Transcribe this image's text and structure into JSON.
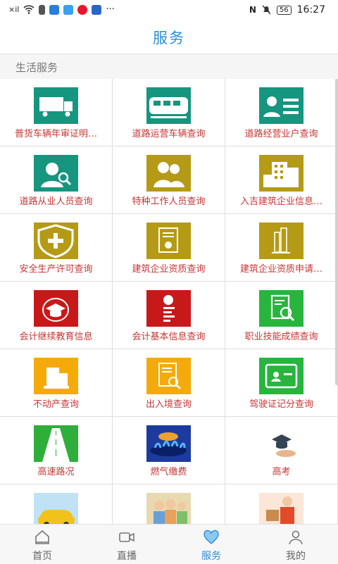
{
  "status_bar": {
    "signal": "×il",
    "time": "16:27",
    "battery": "56",
    "more": "···"
  },
  "header": {
    "title": "服务"
  },
  "section": {
    "title": "生活服务"
  },
  "services": [
    {
      "label": "普货车辆年审证明…",
      "icon": "truck-icon",
      "color": "#16957f"
    },
    {
      "label": "道路运营车辆查询",
      "icon": "train-icon",
      "color": "#16957f"
    },
    {
      "label": "道路经营业户查询",
      "icon": "id-card-icon",
      "color": "#16957f"
    },
    {
      "label": "道路从业人员查询",
      "icon": "person-search-icon",
      "color": "#16957f"
    },
    {
      "label": "特种工作人员查询",
      "icon": "people-icon",
      "color": "#b59a16"
    },
    {
      "label": "入吉建筑企业信息…",
      "icon": "building-icon",
      "color": "#b59a16"
    },
    {
      "label": "安全生产许可查询",
      "icon": "shield-plus-icon",
      "color": "#b59a16"
    },
    {
      "label": "建筑企业资质查询",
      "icon": "certificate-icon",
      "color": "#b59a16"
    },
    {
      "label": "建筑企业资质申请…",
      "icon": "tower-icon",
      "color": "#b59a16"
    },
    {
      "label": "会计继续教育信息",
      "icon": "graduation-cap-icon",
      "color": "#c8191a"
    },
    {
      "label": "会计基本信息查询",
      "icon": "yuan-document-icon",
      "color": "#c8191a"
    },
    {
      "label": "职业技能成绩查询",
      "icon": "document-search-icon",
      "color": "#27b53e"
    },
    {
      "label": "不动产查询",
      "icon": "real-estate-icon",
      "color": "#f5aa0c"
    },
    {
      "label": "出入境查询",
      "icon": "document-magnifier-icon",
      "color": "#f5aa0c"
    },
    {
      "label": "驾驶证记分查询",
      "icon": "license-card-icon",
      "color": "#27b53e"
    },
    {
      "label": "高速路况",
      "icon": "highway-icon",
      "color": "#2fae3a"
    },
    {
      "label": "燃气缴费",
      "icon": "gas-flame-icon",
      "color": "#1d3b9e"
    },
    {
      "label": "高考",
      "icon": "exam-cap-icon",
      "color": "#ffffff"
    },
    {
      "label": "",
      "icon": "taxi-icon",
      "color": "#e8c65a"
    },
    {
      "label": "",
      "icon": "elderly-people-icon",
      "color": "#e8d9b0"
    },
    {
      "label": "",
      "icon": "delivery-icon",
      "color": "#e85a3a"
    }
  ],
  "tabbar": {
    "items": [
      {
        "label": "首页",
        "icon": "home-icon"
      },
      {
        "label": "直播",
        "icon": "video-camera-icon"
      },
      {
        "label": "服务",
        "icon": "heart-service-icon"
      },
      {
        "label": "我的",
        "icon": "user-icon"
      }
    ],
    "active_color": "#2a8fd8"
  }
}
